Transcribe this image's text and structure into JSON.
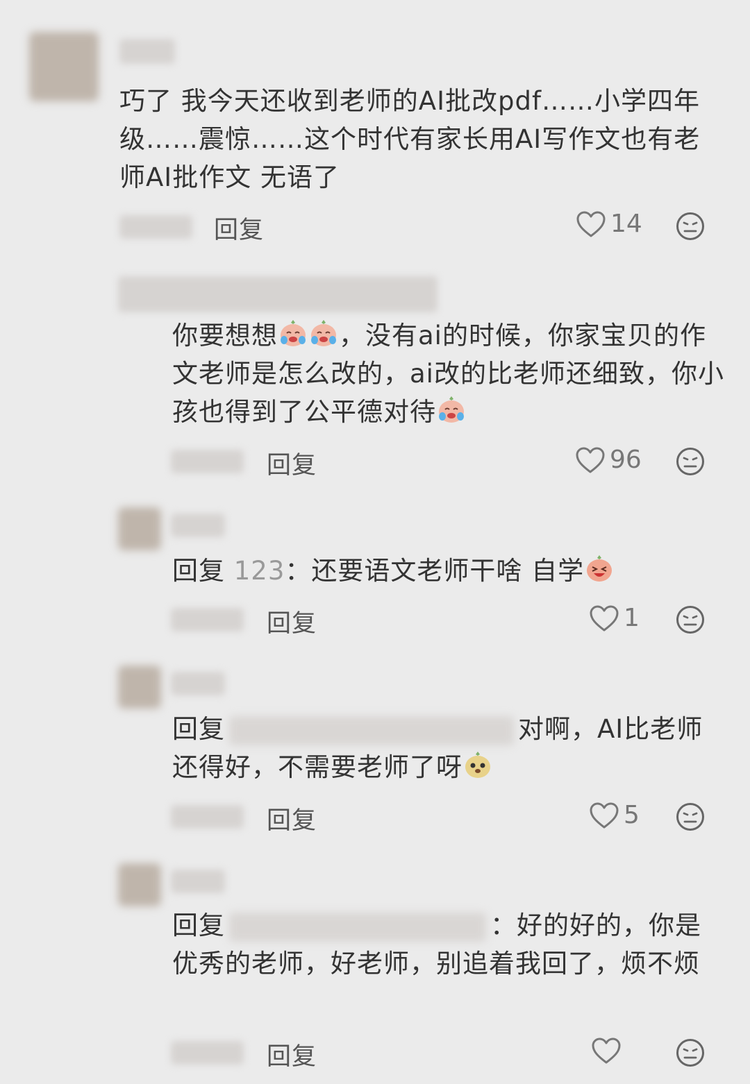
{
  "comments": [
    {
      "text": "巧了 我今天还收到老师的AI批改pdf……小学四年级……震惊……这个时代有家长用AI写作文也有老师AI批作文 无语了",
      "reply_label": "回复",
      "likes": "14"
    },
    {
      "text_a": "你要想想",
      "text_b": "，没有ai的时候，你家宝贝的作文老师是怎么改的，ai改的比老师还细致，你小孩也得到了公平德对待",
      "reply_label": "回复",
      "likes": "96"
    },
    {
      "prefix": "回复",
      "mention": "123",
      "text": "：还要语文老师干啥 自学",
      "reply_label": "回复",
      "likes": "1"
    },
    {
      "prefix": "回复",
      "text": "对啊，AI比老师还得好，不需要老师了呀",
      "reply_label": "回复",
      "likes": "5"
    },
    {
      "prefix": "回复",
      "text": "：好的好的，你是优秀的老师，好老师，别追着我回了，烦不烦",
      "reply_label": "回复",
      "likes": ""
    }
  ],
  "icons": {
    "like": "heart-outline-icon",
    "more": "dizzy-face-icon",
    "emoji_cry": "crying-laughing-emoji",
    "emoji_laugh": "laughing-emoji",
    "emoji_yellow": "yellow-blob-emoji"
  },
  "colors": {
    "background": "#ebebeb",
    "text": "#333333",
    "secondary": "#999999"
  }
}
